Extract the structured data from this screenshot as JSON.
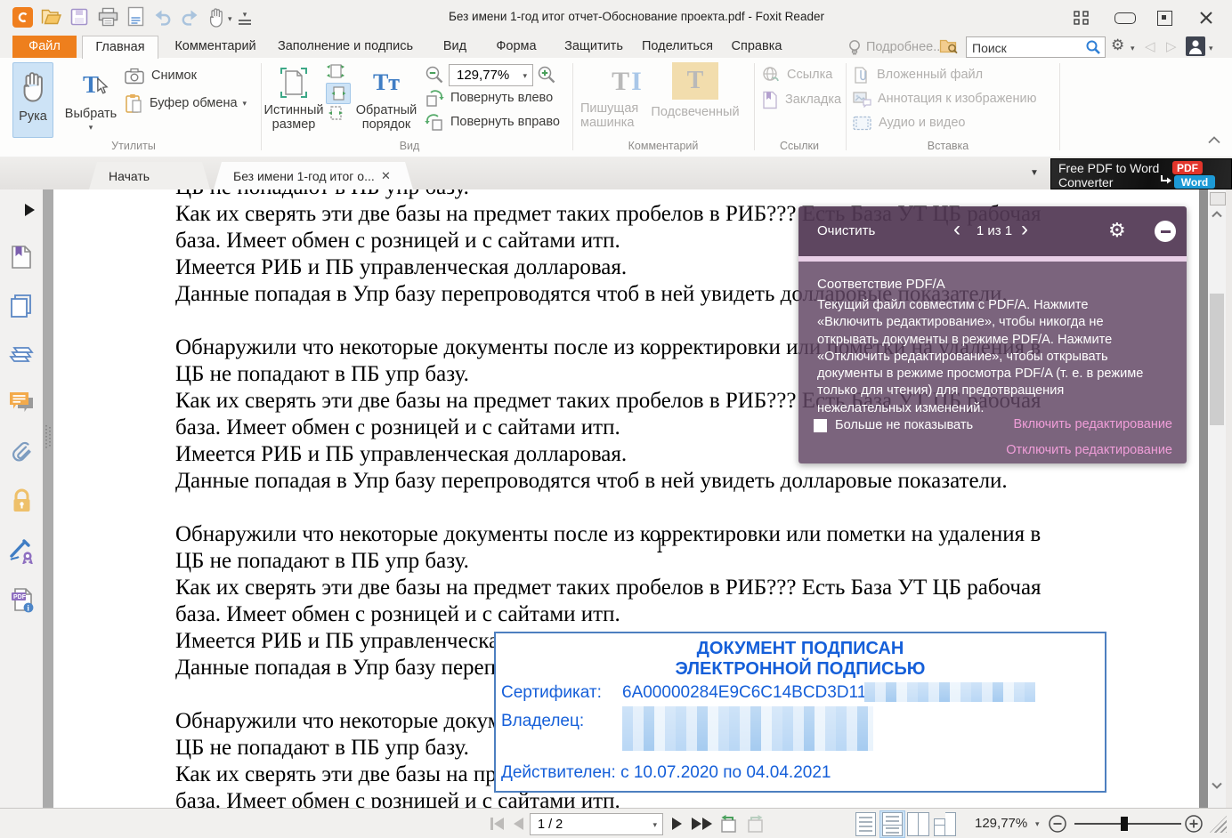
{
  "window": {
    "title": "Без имени 1-год итог отчет-Обоснование проекта.pdf - Foxit Reader"
  },
  "icons": {
    "gear": "⚙",
    "caret_down": "▾",
    "tablist_caret": "▼",
    "close_x": "✕",
    "history_back": "◁",
    "history_forward": "▷",
    "chevron_left": "‹",
    "chevron_right": "›"
  },
  "quick_access_icons": [
    "foxit-logo",
    "open-folder",
    "save",
    "print",
    "email",
    "undo",
    "redo",
    "hand-tool",
    "customize-toolbar"
  ],
  "menu": {
    "tabs": [
      "Файл",
      "Главная",
      "Комментарий",
      "Заполнение и подпись",
      "Вид",
      "Форма",
      "Защитить",
      "Поделиться",
      "Справка"
    ],
    "more": "Подробнее...",
    "search_placeholder": "Поиск"
  },
  "ribbon": {
    "utilities": {
      "hand": "Рука",
      "select": "Выбрать",
      "snapshot": "Снимок",
      "clipboard": "Буфер обмена",
      "group": "Утилиты"
    },
    "view": {
      "actual_size_l1": "Истинный",
      "actual_size_l2": "размер",
      "reverse_l1": "Обратный",
      "reverse_l2": "порядок",
      "reverse_glyph": "Tт",
      "zoom_value": "129,77%",
      "rotate_left": "Повернуть влево",
      "rotate_right": "Повернуть вправо",
      "group": "Вид"
    },
    "comment": {
      "typewriter_l1": "Пишущая",
      "typewriter_l2": "машинка",
      "typewriter_glyph_t": "T",
      "typewriter_glyph_i": "I",
      "highlighted": "Подсвеченный",
      "highlighted_glyph": "T",
      "group": "Комментарий"
    },
    "links": {
      "link": "Ссылка",
      "bookmark": "Закладка",
      "group": "Ссылки"
    },
    "insert": {
      "attached_file": "Вложенный файл",
      "image_annotation": "Аннотация к изображению",
      "audio_video": "Аудио и видео",
      "group": "Вставка"
    }
  },
  "tab_bar": {
    "start_tab": "Начать",
    "document_tab": "Без имени 1-год итог о...",
    "ad": {
      "line1": "Free PDF to Word",
      "line2": "Converter",
      "badge_pdf": "PDF",
      "badge_word": "Word"
    }
  },
  "document": {
    "text": "ЦБ не попадают в ПБ упр базу.\nКак их сверять эти две базы на предмет таких пробелов в РИБ??? Есть База УТ ЦБ рабочая\nбаза. Имеет обмен с розницей и с сайтами итп.\nИмеется РИБ  и ПБ управленческая долларовая.\nДанные попадая в Упр базу перепроводятся чтоб в ней увидеть долларовые показатели.\n\nОбнаружили что некоторые документы после из корректировки или пометки на удаления в\nЦБ не попадают в ПБ упр базу.\nКак их сверять эти две базы на предмет таких пробелов в РИБ??? Есть База УТ ЦБ рабочая\nбаза. Имеет обмен с розницей и с сайтами итп.\nИмеется РИБ  и ПБ управленческая долларовая.\nДанные попадая в Упр базу перепроводятся чтоб в ней увидеть долларовые показатели.\n\nОбнаружили что некоторые документы после из корректировки или пометки на удаления в\nЦБ не попадают в ПБ упр базу.\nКак их сверять эти две базы на предмет таких пробелов в РИБ??? Есть База УТ ЦБ рабочая\nбаза. Имеет обмен с розницей и с сайтами итп.\nИмеется РИБ  и ПБ управленческая долларовая.\nДанные попадая в Упр базу перепроводятся чтоб в ней увидеть долларовые показатели.\n\nОбнаружили что некоторые документы после из корректировки или пометки на удаления в\nЦБ не попадают в ПБ упр базу.\nКак их сверять эти две базы на предмет таких пробелов в РИБ??? Есть База УТ ЦБ рабочая\nбаза. Имеет обмен с розницей и с сайтами итп."
  },
  "signature": {
    "title_line1": "ДОКУМЕНТ ПОДПИСАН",
    "title_line2": "ЭЛЕКТРОННОЙ ПОДПИСЬЮ",
    "cert_label": "Сертификат:",
    "cert_value": "6A00000284E9C6C14BCD3D11",
    "owner_label": "Владелец:",
    "valid_text": "Действителен: с 10.07.2020 по 04.04.2021"
  },
  "pdfa_popup": {
    "clear": "Очистить",
    "pager": "1 из 1",
    "title": "Соответствие PDF/A",
    "body": "Текущий файл совместим с PDF/A. Нажмите\n«Включить редактирование», чтобы никогда не\nоткрывать документы в режиме PDF/A. Нажмите\n«Отключить редактирование», чтобы открывать\nдокументы в режиме просмотра PDF/A (т. е. в режиме\nтолько для чтения) для предотвращения\nнежелательных изменений.",
    "dont_show": "Больше не показывать",
    "enable_link": "Включить редактирование",
    "disable_link": "Отключить редактирование"
  },
  "status_bar": {
    "page_field": "1 / 2",
    "zoom_value": "129,77%"
  },
  "colors": {
    "accent_orange": "#ee7f1d",
    "selection_blue": "#cde3f6",
    "popup_purple": "#624664",
    "link_pink": "#f09ed9",
    "signature_blue": "#155fd9",
    "doc_background": "#8f8f8f",
    "ad_pdf_red": "#e2352b",
    "ad_word_blue": "#1d9ad6"
  }
}
